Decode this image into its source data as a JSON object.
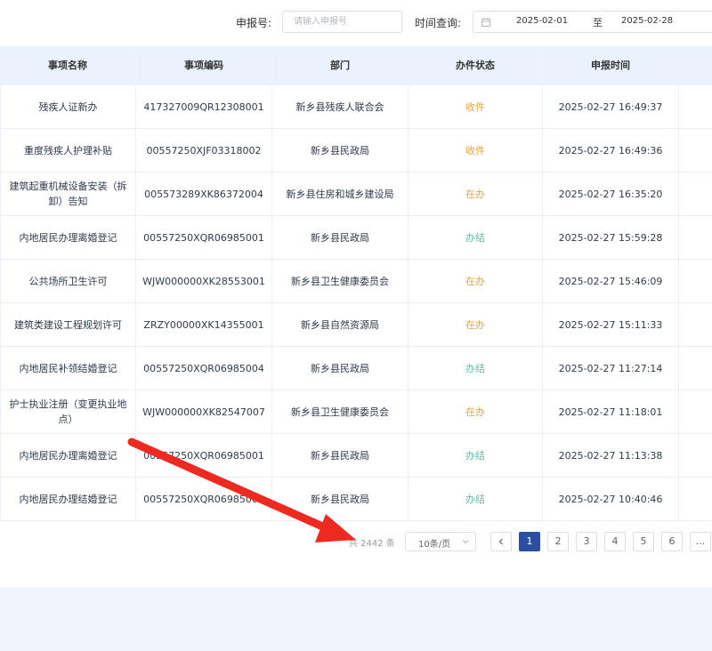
{
  "filters": {
    "report_no_label": "申报号:",
    "report_no_placeholder": "请输入申报号",
    "time_label": "时间查询:",
    "date_start": "2025-02-01",
    "date_separator": "至",
    "date_end": "2025-02-28"
  },
  "table": {
    "columns": [
      "事项名称",
      "事项编码",
      "部门",
      "办件状态",
      "申报时间"
    ],
    "rows": [
      {
        "name": "残疾人证新办",
        "code": "417327009QR12308001",
        "dept": "新乡县残疾人联合会",
        "status": "收件",
        "status_color": "#e6a23c",
        "time": "2025-02-27 16:49:37"
      },
      {
        "name": "重度残疾人护理补贴",
        "code": "00557250XJF03318002",
        "dept": "新乡县民政局",
        "status": "收件",
        "status_color": "#e6a23c",
        "time": "2025-02-27 16:49:36"
      },
      {
        "name": "建筑起重机械设备安装（拆卸）告知",
        "code": "005573289XK86372004",
        "dept": "新乡县住房和城乡建设局",
        "status": "在办",
        "status_color": "#e6a23c",
        "time": "2025-02-27 16:35:20"
      },
      {
        "name": "内地居民办理离婚登记",
        "code": "00557250XQR06985001",
        "dept": "新乡县民政局",
        "status": "办结",
        "status_color": "#5bc0a8",
        "time": "2025-02-27 15:59:28"
      },
      {
        "name": "公共场所卫生许可",
        "code": "WJW000000XK28553001",
        "dept": "新乡县卫生健康委员会",
        "status": "在办",
        "status_color": "#e6a23c",
        "time": "2025-02-27 15:46:09"
      },
      {
        "name": "建筑类建设工程规划许可",
        "code": "ZRZY00000XK14355001",
        "dept": "新乡县自然资源局",
        "status": "在办",
        "status_color": "#e6a23c",
        "time": "2025-02-27 15:11:33"
      },
      {
        "name": "内地居民补领结婚登记",
        "code": "00557250XQR06985004",
        "dept": "新乡县民政局",
        "status": "办结",
        "status_color": "#5bc0a8",
        "time": "2025-02-27 11:27:14"
      },
      {
        "name": "护士执业注册（变更执业地点）",
        "code": "WJW000000XK82547007",
        "dept": "新乡县卫生健康委员会",
        "status": "在办",
        "status_color": "#e6a23c",
        "time": "2025-02-27 11:18:01"
      },
      {
        "name": "内地居民办理离婚登记",
        "code": "00557250XQR06985001",
        "dept": "新乡县民政局",
        "status": "办结",
        "status_color": "#5bc0a8",
        "time": "2025-02-27 11:13:38"
      },
      {
        "name": "内地居民办理结婚登记",
        "code": "00557250XQR06985003",
        "dept": "新乡县民政局",
        "status": "办结",
        "status_color": "#5bc0a8",
        "time": "2025-02-27 10:40:46"
      }
    ]
  },
  "pagination": {
    "total_text": "共 2442 条",
    "page_size": "10条/页",
    "prev_icon": "chevron-left-icon",
    "pages": [
      "1",
      "2",
      "3",
      "4",
      "5",
      "6"
    ],
    "more": "...",
    "current": "1",
    "active_color": "#2b4fa0"
  },
  "annotation": {
    "arrow_color": "#ee2a20",
    "arrow_icon": "red-arrow-annotation"
  }
}
